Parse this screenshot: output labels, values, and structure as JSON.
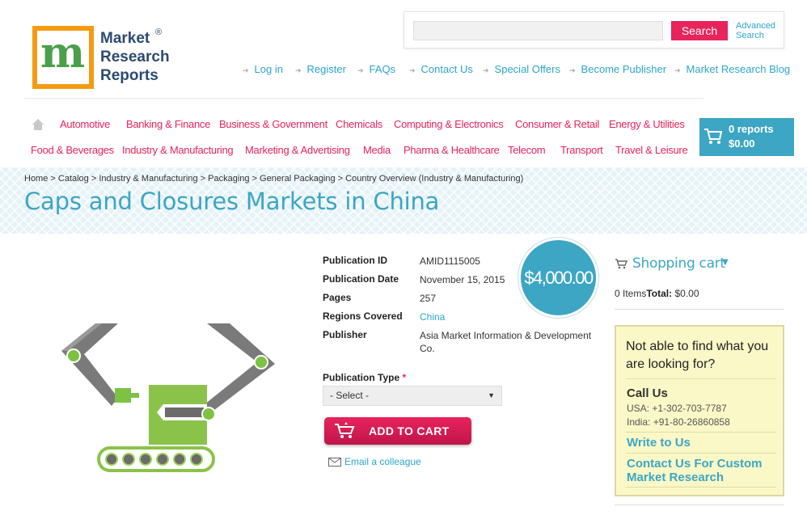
{
  "logo": {
    "line1": "Market",
    "line2": "Research",
    "line3": "Reports",
    "reg": "®"
  },
  "search": {
    "placeholder": "",
    "button": "Search",
    "advanced_line1": "Advanced",
    "advanced_line2": "Search"
  },
  "top_links": [
    "Log in",
    "Register",
    "FAQs",
    "Contact Us",
    "Special Offers",
    "Become Publisher",
    "Market Research Blog"
  ],
  "nav": {
    "row1": [
      "Automotive",
      "Banking & Finance",
      "Business & Government",
      "Chemicals",
      "Computing & Electronics",
      "Consumer & Retail",
      "Energy & Utilities"
    ],
    "row2": [
      "Food & Beverages",
      "Industry & Manufacturing",
      "Marketing & Advertising",
      "Media",
      "Pharma & Healthcare",
      "Telecom",
      "Transport",
      "Travel & Leisure"
    ]
  },
  "cart": {
    "reports": "0 reports",
    "amount": "$0.00"
  },
  "breadcrumb": "Home > Catalog > Industry & Manufacturing > Packaging > General Packaging > Country Overview (Industry & Manufacturing)",
  "title": "Caps and Closures Markets in China",
  "details": {
    "publication_id_label": "Publication ID",
    "publication_id": "AMID1115005",
    "publication_date_label": "Publication Date",
    "publication_date": "November 15, 2015",
    "pages_label": "Pages",
    "pages": "257",
    "regions_label": "Regions Covered",
    "regions": "China",
    "publisher_label": "Publisher",
    "publisher": "Asia Market Information & Development Co."
  },
  "price": "$4,000.00",
  "publication_type": {
    "label": "Publication Type",
    "required": "*",
    "selected": "- Select -"
  },
  "add_to_cart": "ADD TO CART",
  "email_colleague": "Email a colleague",
  "shopping_cart": {
    "title": "Shopping cart",
    "items": "0 Items",
    "total_label": "Total:",
    "total": "$0.00"
  },
  "help": {
    "question": "Not able to find what you are looking for?",
    "call_us": "Call Us",
    "usa": "USA: +1-302-703-7787",
    "india": "India: +91-80-26860858",
    "write_to_us": "Write to Us",
    "custom": "Contact Us For Custom Market Research"
  },
  "colors": {
    "accent_pink": "#e8245c",
    "accent_blue": "#3ca6c4",
    "link_blue": "#2ba6cb"
  }
}
